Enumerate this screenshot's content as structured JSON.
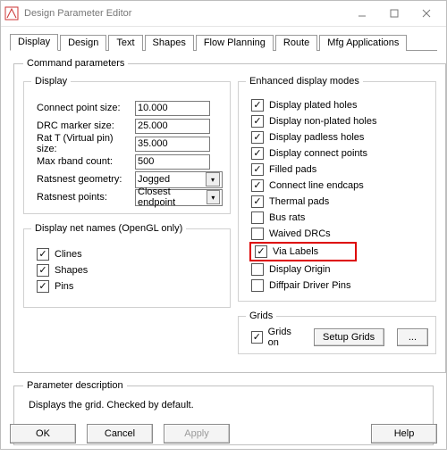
{
  "window": {
    "title": "Design Parameter Editor"
  },
  "tabs": [
    "Display",
    "Design",
    "Text",
    "Shapes",
    "Flow Planning",
    "Route",
    "Mfg Applications"
  ],
  "cmd_group_label": "Command parameters",
  "display_group_label": "Display",
  "fields": {
    "connect_point_size": {
      "label": "Connect point size:",
      "value": "10.000"
    },
    "drc_marker_size": {
      "label": "DRC marker size:",
      "value": "25.000"
    },
    "rat_t_size": {
      "label": "Rat T (Virtual pin) size:",
      "value": "35.000"
    },
    "max_rband": {
      "label": "Max rband count:",
      "value": "500"
    },
    "ratsnest_geom": {
      "label": "Ratsnest geometry:",
      "value": "Jogged"
    },
    "ratsnest_points": {
      "label": "Ratsnest points:",
      "value": "Closest endpoint"
    }
  },
  "netnames": {
    "group_label": "Display net names (OpenGL only)",
    "items": [
      {
        "label": "Clines",
        "checked": true
      },
      {
        "label": "Shapes",
        "checked": true
      },
      {
        "label": "Pins",
        "checked": true
      }
    ]
  },
  "enhanced": {
    "group_label": "Enhanced display modes",
    "items": [
      {
        "label": "Display plated holes",
        "checked": true
      },
      {
        "label": "Display non-plated holes",
        "checked": true
      },
      {
        "label": "Display padless holes",
        "checked": true
      },
      {
        "label": "Display connect points",
        "checked": true
      },
      {
        "label": "Filled pads",
        "checked": true
      },
      {
        "label": "Connect line endcaps",
        "checked": true
      },
      {
        "label": "Thermal pads",
        "checked": true
      },
      {
        "label": "Bus rats",
        "checked": false
      },
      {
        "label": "Waived DRCs",
        "checked": false
      },
      {
        "label": "Via Labels",
        "checked": true,
        "highlight": true
      },
      {
        "label": "Display Origin",
        "checked": false
      },
      {
        "label": "Diffpair Driver Pins",
        "checked": false
      }
    ]
  },
  "grids": {
    "group_label": "Grids",
    "on_label": "Grids on",
    "on_checked": true,
    "setup_label": "Setup Grids",
    "dots": "..."
  },
  "paramdesc": {
    "group_label": "Parameter description",
    "text": "Displays the grid. Checked by default."
  },
  "buttons": {
    "ok": "OK",
    "cancel": "Cancel",
    "apply": "Apply",
    "help": "Help"
  }
}
